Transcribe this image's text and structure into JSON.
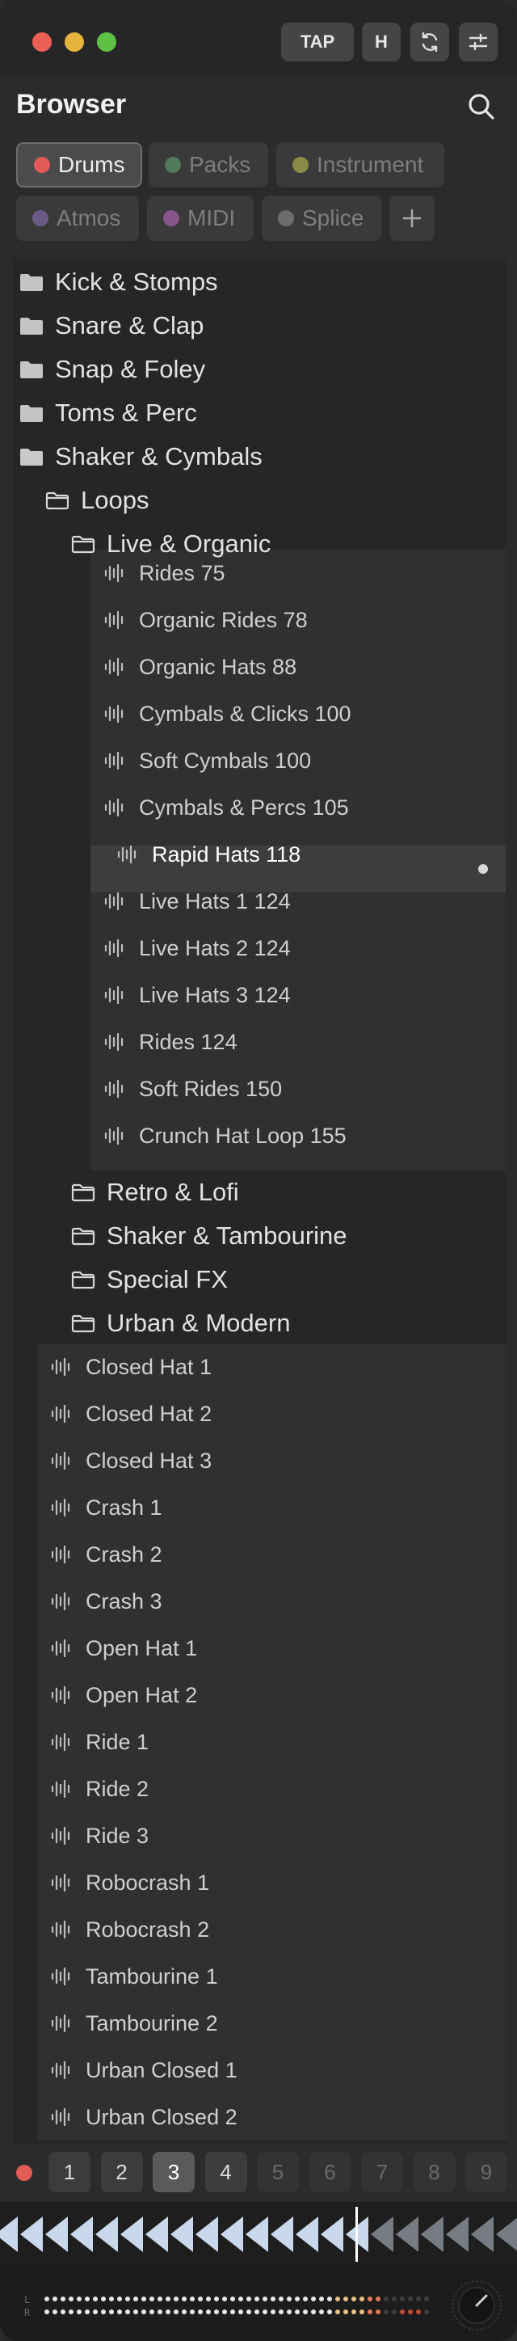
{
  "titlebar": {
    "tap_label": "TAP",
    "h_label": "H",
    "icons": [
      "sync-icon",
      "mixer-sliders-icon"
    ]
  },
  "browser": {
    "title": "Browser"
  },
  "categories": [
    {
      "label": "Drums",
      "color": "#e05a58",
      "active": true
    },
    {
      "label": "Packs",
      "color": "#4f7a5a",
      "active": false
    },
    {
      "label": "Instrument",
      "color": "#8a8a46",
      "active": false
    },
    {
      "label": "Atmos",
      "color": "#6a5a86",
      "active": false
    },
    {
      "label": "MIDI",
      "color": "#86568a",
      "active": false
    },
    {
      "label": "Splice",
      "color": "#6c6c6c",
      "active": false
    }
  ],
  "tree": {
    "root_folders": [
      "Kick & Stomps",
      "Snare & Clap",
      "Snap & Foley",
      "Toms & Perc",
      "Shaker & Cymbals"
    ],
    "loops_folder": "Loops",
    "live_organic_folder": "Live & Organic",
    "loop_files": [
      "Rides 75",
      "Organic Rides 78",
      "Organic Hats 88",
      "Cymbals & Clicks 100",
      "Soft Cymbals 100",
      "Cymbals & Percs 105",
      "Rapid Hats 118",
      "Live Hats 1 124",
      "Live Hats 2 124",
      "Live Hats 3 124",
      "Rides 124",
      "Soft Rides 150",
      "Crunch Hat Loop 155"
    ],
    "selected_file": "Rapid Hats 118",
    "loop_subfolders": [
      "Retro & Lofi",
      "Shaker & Tambourine",
      "Special FX",
      "Urban & Modern"
    ],
    "oneshot_files": [
      "Closed Hat 1",
      "Closed Hat 2",
      "Closed Hat 3",
      "Crash 1",
      "Crash 2",
      "Crash 3",
      "Open Hat 1",
      "Open Hat 2",
      "Ride 1",
      "Ride 2",
      "Ride 3",
      "Robocrash 1",
      "Robocrash 2",
      "Tambourine 1",
      "Tambourine 2",
      "Urban Closed 1",
      "Urban Closed 2"
    ]
  },
  "footer": {
    "slots": [
      "1",
      "2",
      "3",
      "4",
      "5",
      "6",
      "7",
      "8",
      "9"
    ],
    "active_slot": "3",
    "meter_labels": [
      "L",
      "R"
    ]
  }
}
